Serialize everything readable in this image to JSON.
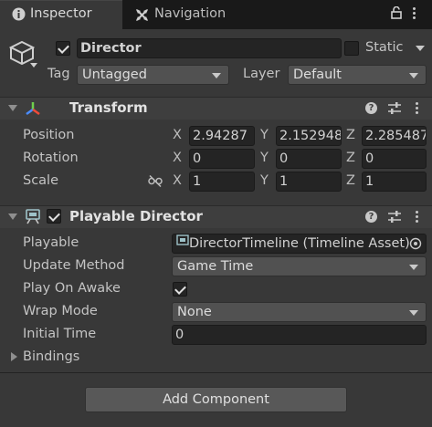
{
  "tabs": [
    {
      "label": "Inspector",
      "icon": "info-icon",
      "active": true
    },
    {
      "label": "Navigation",
      "icon": "navigation-icon",
      "active": false
    }
  ],
  "gameobject": {
    "icon": "cube-icon",
    "active": true,
    "name": "Director",
    "static_label": "Static",
    "static": false,
    "tag_label": "Tag",
    "tag_value": "Untagged",
    "layer_label": "Layer",
    "layer_value": "Default"
  },
  "transform": {
    "title": "Transform",
    "icon": "transform-axes-icon",
    "rows": [
      {
        "label": "Position",
        "x": "2.94287",
        "y": "2.152948",
        "z": "2.285487"
      },
      {
        "label": "Rotation",
        "x": "0",
        "y": "0",
        "z": "0"
      },
      {
        "label": "Scale",
        "x": "1",
        "y": "1",
        "z": "1"
      }
    ],
    "axis_labels": [
      "X",
      "Y",
      "Z"
    ],
    "scale_link_icon": "unlink-icon"
  },
  "playable_director": {
    "title": "Playable Director",
    "icon": "playable-director-icon",
    "enabled": true,
    "playable_label": "Playable",
    "playable_value": "DirectorTimeline (Timeline Asset)",
    "update_method_label": "Update Method",
    "update_method_value": "Game Time",
    "play_on_awake_label": "Play On Awake",
    "play_on_awake": true,
    "wrap_mode_label": "Wrap Mode",
    "wrap_mode_value": "None",
    "initial_time_label": "Initial Time",
    "initial_time_value": "0",
    "bindings_label": "Bindings"
  },
  "add_component_label": "Add Component",
  "header_icons": {
    "help": "?",
    "presets": "sliders-icon",
    "menu": "kebab-icon"
  },
  "colors": {
    "background": "#383838",
    "tabbar": "#191919",
    "field": "#242424",
    "dropdown": "#515151"
  }
}
